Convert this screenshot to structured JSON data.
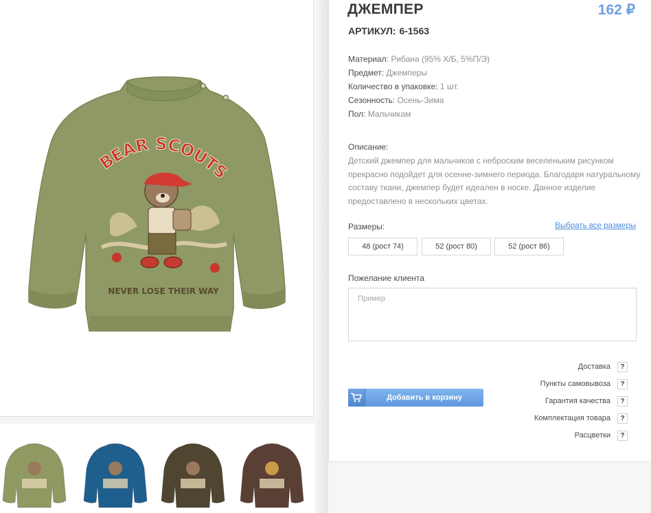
{
  "product": {
    "title": "ДЖЕМПЕР",
    "price": "162 ₽",
    "article_label": "АРТИКУЛ:",
    "article_value": "6-1563"
  },
  "properties": [
    {
      "label": "Материал:",
      "value": "Рибана (95% Х/Б, 5%П/Э)"
    },
    {
      "label": "Предмет:",
      "value": "Джемперы"
    },
    {
      "label": "Количество в упаковке:",
      "value": "1 шт."
    },
    {
      "label": "Сезонность:",
      "value": "Осень-Зима"
    },
    {
      "label": "Пол:",
      "value": "Мальчикам"
    }
  ],
  "description": {
    "label": "Описание:",
    "text": "Детский джемпер для мальчиков с неброским веселеньким рисунком прекрасно подойдет для осенне-зимнего периода. Благодаря натуральному составу ткани, джемпер будет идеален в носке. Данное изделие предоставлено в нескольких цветах."
  },
  "sizes": {
    "label": "Размеры:",
    "select_all": "Выбрать все размеры",
    "options": [
      "48 (рост 74)",
      "52 (рост 80)",
      "52 (рост 86)"
    ]
  },
  "wish": {
    "label": "Пожелание клиента",
    "placeholder": "Пример",
    "value": ""
  },
  "cart": {
    "label": "Добавить в корзину",
    "icon": "cart-icon"
  },
  "info_links": [
    {
      "label": "Доставка",
      "help": "?"
    },
    {
      "label": "Пункты самовывоза",
      "help": "?"
    },
    {
      "label": "Гарантия качества",
      "help": "?"
    },
    {
      "label": "Комплектация товара",
      "help": "?"
    },
    {
      "label": "Расцветки",
      "help": "?"
    }
  ],
  "image": {
    "print_title": "BEAR SCOUTS",
    "print_slogan": "NEVER LOSE THEIR WAY"
  },
  "colors": {
    "price": "#6f9fdf",
    "link": "#4b8ed9",
    "cart_button": "#6fa4e4",
    "thumb_variants": [
      "#8e9a62",
      "#1f5f8e",
      "#4f4530",
      "#5a3f35"
    ]
  }
}
